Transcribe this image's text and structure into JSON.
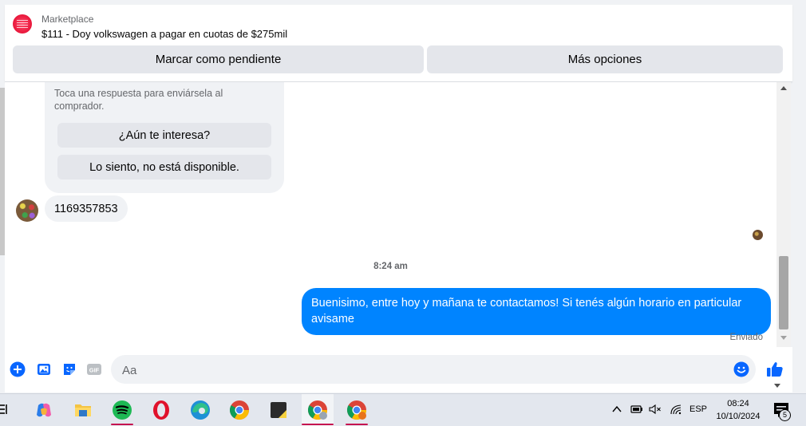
{
  "header": {
    "category": "Marketplace",
    "listing_title": "$111 - Doy volkswagen a pagar en cuotas de $275mil",
    "buttons": {
      "mark_pending": "Marcar como pendiente",
      "more_options": "Más opciones"
    }
  },
  "chat": {
    "quick_replies_help": "Toca una respuesta para enviársela al comprador.",
    "quick_replies": [
      "¿Aún te interesa?",
      "Lo siento, no está disponible."
    ],
    "incoming_message": "1169357853",
    "timestamp": "8:24 am",
    "outgoing_message": "Buenisimo, entre hoy y mañana te contactamos! Si tenés algún horario en particular avisame",
    "status": "Enviado"
  },
  "composer": {
    "placeholder": "Aa",
    "icons": [
      "plus-icon",
      "image-icon",
      "sticker-icon",
      "gif-icon",
      "emoji-icon",
      "thumbs-up-icon"
    ]
  },
  "taskbar": {
    "apps": [
      "copilot-icon",
      "file-explorer-icon",
      "spotify-icon",
      "opera-icon",
      "edge-icon",
      "chrome-icon",
      "sticky-notes-icon",
      "chrome-profile-icon",
      "chrome-profile-2-icon"
    ],
    "language": "ESP",
    "time": "08:24",
    "date": "10/10/2024",
    "notification_count": "5"
  },
  "colors": {
    "accent": "#0084ff",
    "button_gray": "#e4e6eb",
    "bubble_gray": "#f0f2f5",
    "taskbar_underline": "#c5114f"
  }
}
